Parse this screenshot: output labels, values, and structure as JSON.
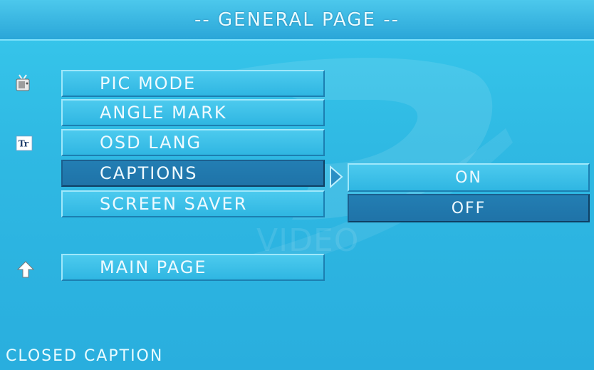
{
  "header": {
    "title": "-- GENERAL PAGE --"
  },
  "menu": {
    "items": [
      {
        "label": "PIC MODE"
      },
      {
        "label": "ANGLE MARK"
      },
      {
        "label": "OSD LANG"
      },
      {
        "label": "CAPTIONS"
      },
      {
        "label": "SCREEN SAVER"
      }
    ],
    "selected": "CAPTIONS",
    "main_page": "MAIN PAGE"
  },
  "submenu": {
    "options": [
      {
        "label": "ON"
      },
      {
        "label": "OFF"
      }
    ],
    "selected": "OFF"
  },
  "watermark": {
    "text": "VIDEO"
  },
  "status": {
    "hint": "CLOSED CAPTION"
  },
  "icons": {
    "tv": "tv-icon",
    "text": "text-language-icon",
    "up": "up-arrow-icon",
    "pointer": "selection-pointer-icon"
  },
  "colors": {
    "background": "#2fb9e3",
    "selected": "#1f73a8",
    "border_light": "#9fe8fb",
    "text": "#eefaff"
  }
}
